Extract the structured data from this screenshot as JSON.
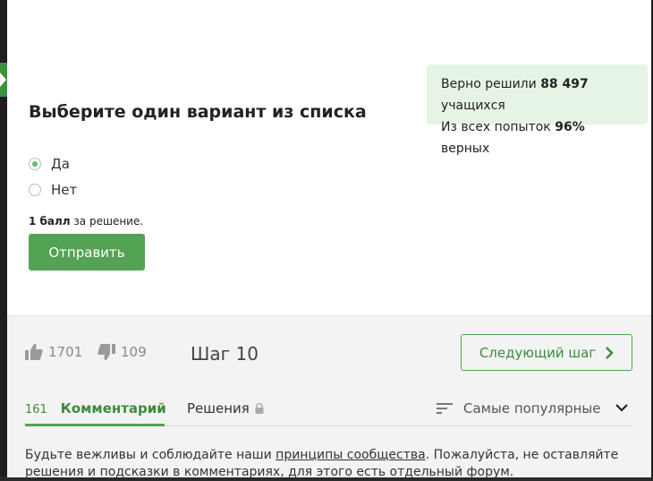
{
  "stats": {
    "solved_prefix": "Верно решили",
    "solved_count": "88 497",
    "solved_suffix": "учащихся",
    "attempts_prefix": "Из всех попыток",
    "attempts_percent": "96%",
    "attempts_suffix": "верных"
  },
  "question": {
    "title": "Выберите один вариант из списка",
    "options": [
      {
        "label": "Да",
        "checked": true
      },
      {
        "label": "Нет",
        "checked": false
      }
    ],
    "points_bold": "1 балл",
    "points_rest": "за решение.",
    "submit_label": "Отправить"
  },
  "footer": {
    "likes": "1701",
    "dislikes": "109",
    "step_label": "Шаг 10",
    "next_label": "Следующий шаг"
  },
  "comments": {
    "count": "161",
    "tab_label": "Комментарий",
    "solutions_label": "Решения",
    "sort_label": "Самые популярные",
    "notice_part1": "Будьте вежливы и соблюдайте наши ",
    "notice_link": "принципы сообщества",
    "notice_part2": ". Пожалуйста, не оставляйте решения и подсказки в комментариях, для этого есть отдельный форум."
  },
  "colors": {
    "accent": "#54a254",
    "accent_dark": "#3a8c3a",
    "stats_bg": "#e6f4e6",
    "footer_bg": "#f3f3f3"
  },
  "icons": [
    "sidebar-toggle-icon",
    "thumbs-up-icon",
    "thumbs-down-icon",
    "chevron-right-icon",
    "lock-icon",
    "sort-icon",
    "chevron-down-icon"
  ]
}
